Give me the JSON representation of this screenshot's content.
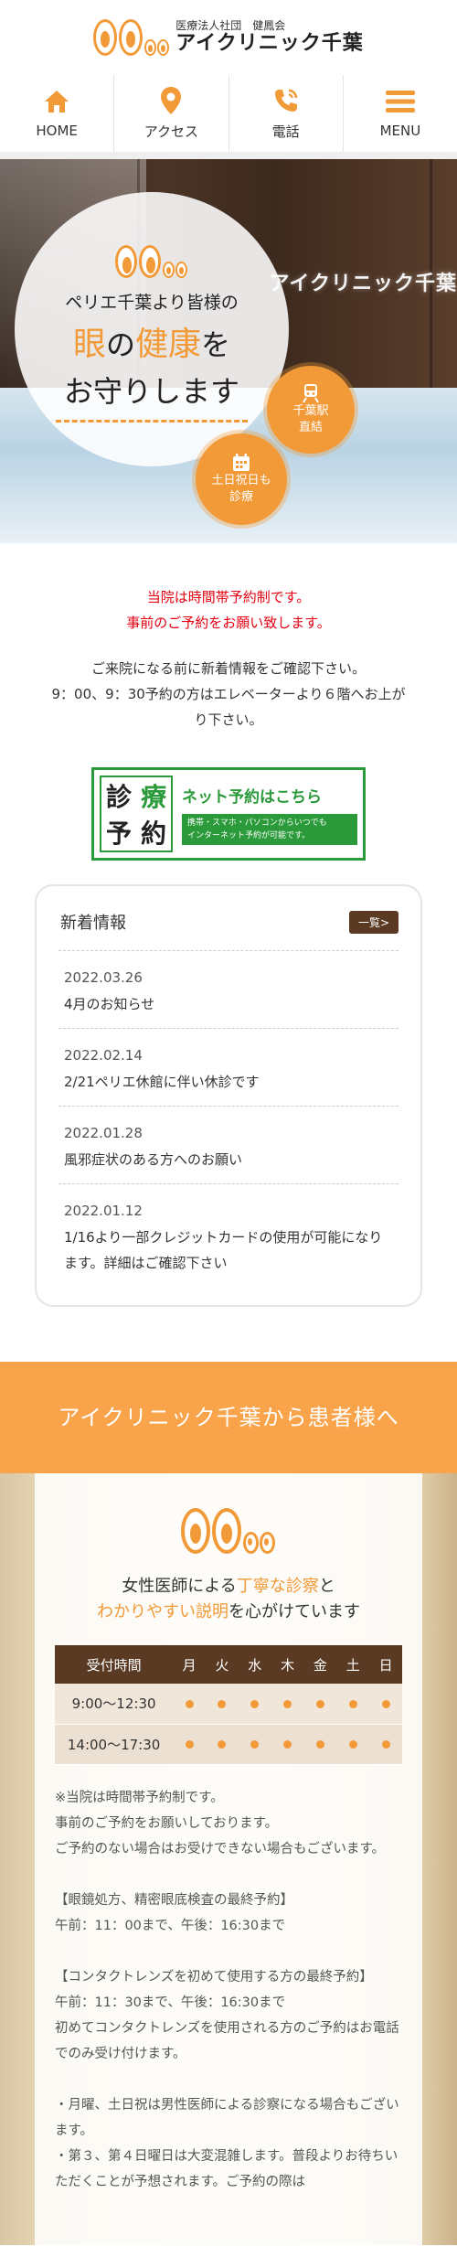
{
  "header": {
    "logo_sub": "医療法人社団　健鳳会",
    "logo_main": "アイクリニック千葉"
  },
  "nav": [
    {
      "label": "HOME",
      "icon": "home-icon"
    },
    {
      "label": "アクセス",
      "icon": "map-pin-icon"
    },
    {
      "label": "電話",
      "icon": "phone-icon"
    },
    {
      "label": "MENU",
      "icon": "hamburger-icon"
    }
  ],
  "hero": {
    "sign": "アイクリニック千葉",
    "line1": "ペリエ千葉より皆様の",
    "line2_a": "眼",
    "line2_b": "の",
    "line2_c": "健康",
    "line2_d": "を",
    "line3": "お守りします",
    "badge_station": [
      "千葉駅",
      "直結"
    ],
    "badge_weekend": [
      "土日祝日も",
      "診療"
    ]
  },
  "notice": {
    "red": [
      "当院は時間帯予約制です。",
      "事前のご予約をお願い致します。"
    ],
    "black": [
      "ご来院になる前に新着情報をご確認下さい。",
      "9：00、9：30予約の方はエレベーターより６階へお上が",
      "り下さい。"
    ]
  },
  "reserve": {
    "chars": [
      "診",
      "療",
      "予",
      "約"
    ],
    "title": "ネット予約はこちら",
    "sub": [
      "携帯・スマホ・パソコンからいつでも",
      "インターネット予約が可能です。"
    ]
  },
  "news": {
    "title": "新着情報",
    "more": "一覧>",
    "items": [
      {
        "date": "2022.03.26",
        "text": "4月のお知らせ"
      },
      {
        "date": "2022.02.14",
        "text": "2/21ペリエ休館に伴い休診です"
      },
      {
        "date": "2022.01.28",
        "text": "風邪症状のある方へのお願い"
      },
      {
        "date": "2022.01.12",
        "text": "1/16より一部クレジットカードの使用が可能になります。詳細はご確認下さい"
      }
    ]
  },
  "message": {
    "band_title": "アイクリニック千葉から患者様へ",
    "tag1_a": "女性医師による",
    "tag1_b": "丁寧な診察",
    "tag1_c": "と",
    "tag2_a": "わかりやすい説明",
    "tag2_b": "を心がけています",
    "table": {
      "header": [
        "受付時間",
        "月",
        "火",
        "水",
        "木",
        "金",
        "土",
        "日"
      ],
      "rows": [
        {
          "time": "9:00〜12:30"
        },
        {
          "time": "14:00〜17:30"
        }
      ]
    },
    "notes": [
      "※当院は時間帯予約制です。",
      "事前のご予約をお願いしております。",
      "ご予約のない場合はお受けできない場合もございます。",
      "",
      "【眼鏡処方、精密眼底検査の最終予約】",
      "午前：11：00まで、午後：16:30まで",
      "",
      "【コンタクトレンズを初めて使用する方の最終予約】",
      "午前：11：30まで、午後：16:30まで",
      "初めてコンタクトレンズを使用される方のご予約はお電話でのみ受け付けます。",
      "",
      "・月曜、土日祝は男性医師による診察になる場合もございます。",
      "・第３、第４日曜日は大変混雑します。普段よりお待ちいただくことが予想されます。ご予約の際は"
    ]
  },
  "colors": {
    "accent": "#f29a38",
    "band": "#f9a34b",
    "brown": "#5a3a23",
    "green": "#2b9a3a",
    "red": "#e60012"
  }
}
